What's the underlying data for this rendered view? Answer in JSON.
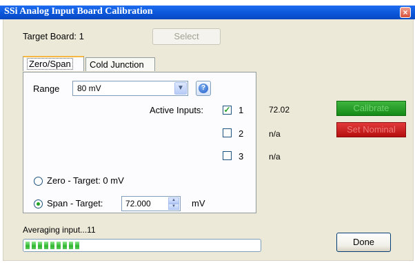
{
  "window": {
    "title": "SSi Analog Input Board Calibration",
    "close_glyph": "×"
  },
  "target": {
    "label": "Target Board: 1",
    "select_label": "Select"
  },
  "tabs": [
    {
      "label": "Zero/Span",
      "active": true
    },
    {
      "label": "Cold Junction",
      "active": false
    }
  ],
  "range": {
    "label": "Range",
    "value": "80 mV",
    "help_glyph": "?"
  },
  "active_inputs": {
    "label": "Active Inputs:",
    "inputs": [
      {
        "label": "1",
        "checked": true,
        "reading": "72.02"
      },
      {
        "label": "2",
        "checked": false,
        "reading": "n/a"
      },
      {
        "label": "3",
        "checked": false,
        "reading": "n/a"
      }
    ]
  },
  "mode": {
    "zero_label": "Zero - Target: 0 mV",
    "span_label": "Span - Target:",
    "span_value": "72.000",
    "span_unit": "mV",
    "selected": "span"
  },
  "buttons": {
    "calibrate": "Calibrate",
    "set_nominal": "Set Nominal",
    "done": "Done"
  },
  "status": {
    "text": "Averaging input...11",
    "progress_segments": 9
  },
  "colors": {
    "title_bar": "#0a55d8",
    "calibrate": "#168a16",
    "set_nominal": "#b40f0f",
    "progress": "#2fb52f"
  }
}
